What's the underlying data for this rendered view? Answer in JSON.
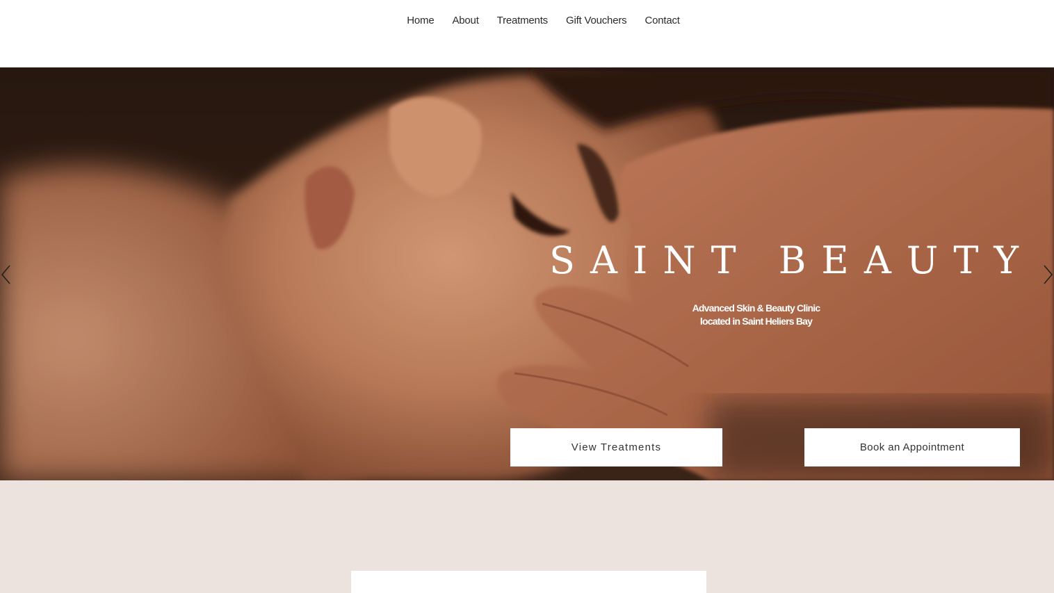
{
  "nav": {
    "items": [
      {
        "label": "Home"
      },
      {
        "label": "About"
      },
      {
        "label": "Treatments"
      },
      {
        "label": "Gift Vouchers"
      },
      {
        "label": "Contact"
      }
    ]
  },
  "hero": {
    "title": "SAINT BEAUTY",
    "subtitle_line1": "Advanced Skin & Beauty Clinic",
    "subtitle_line2": "located in Saint Heliers Bay",
    "buttons": {
      "view_treatments": "View Treatments",
      "book_appointment": "Book an Appointment"
    },
    "slideshow": {
      "prev_icon": "chevron-left-icon",
      "next_icon": "chevron-right-icon"
    }
  },
  "colors": {
    "header_bg": "#ffffff",
    "lower_section_bg": "#ece3de",
    "button_bg": "#ffffff",
    "hero_text": "#ffffff"
  }
}
